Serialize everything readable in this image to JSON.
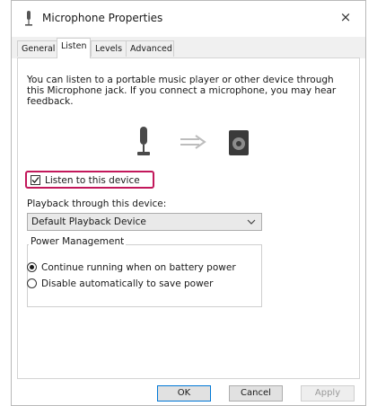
{
  "window": {
    "title": "Microphone Properties",
    "close_label": "×"
  },
  "tabs": [
    {
      "label": "General"
    },
    {
      "label": "Listen",
      "active": true
    },
    {
      "label": "Levels"
    },
    {
      "label": "Advanced"
    }
  ],
  "panel": {
    "description": "You can listen to a portable music player or other device through this Microphone jack. If you connect a microphone, you may hear feedback.",
    "listen_checkbox": {
      "label": "Listen to this device",
      "checked": true
    },
    "playback_label": "Playback through this device:",
    "playback_select": {
      "value": "Default Playback Device"
    },
    "power_management": {
      "legend": "Power Management",
      "options": [
        {
          "label": "Continue running when on battery power",
          "selected": true
        },
        {
          "label": "Disable automatically to save power",
          "selected": false
        }
      ]
    }
  },
  "buttons": {
    "ok": "OK",
    "cancel": "Cancel",
    "apply": "Apply"
  },
  "colors": {
    "highlight": "#c2185b"
  },
  "icons": {
    "title": "microphone-icon",
    "source": "microphone-icon",
    "arrow": "arrow-right-icon",
    "target": "speaker-icon"
  }
}
